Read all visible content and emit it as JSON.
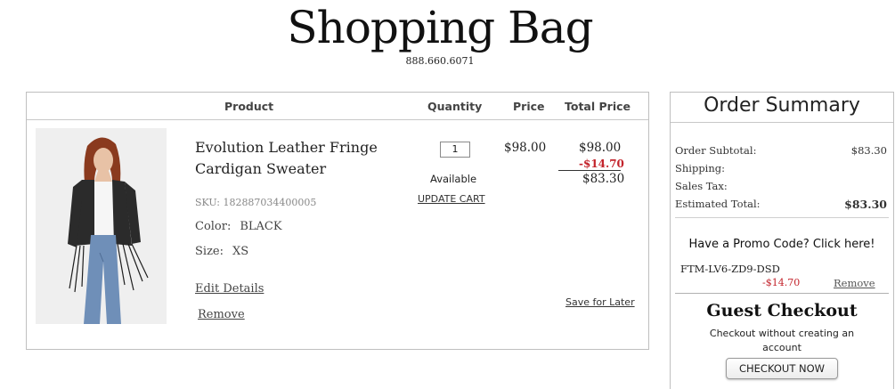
{
  "header": {
    "title": "Shopping Bag",
    "phone": "888.660.6071"
  },
  "cart": {
    "columns": {
      "product": "Product",
      "quantity": "Quantity",
      "price": "Price",
      "total": "Total Price"
    },
    "item": {
      "name": "Evolution Leather Fringe Cardigan Sweater",
      "sku": "SKU: 182887034400005",
      "color_label": "Color:",
      "color_value": "BLACK",
      "size_label": "Size:",
      "size_value": "XS",
      "edit_label": "Edit Details",
      "remove_label": "Remove",
      "quantity": "1",
      "availability": "Available",
      "update_label": "UPDATE CART",
      "unit_price": "$98.00",
      "total_original": "$98.00",
      "total_discount": "-$14.70",
      "total_final": "$83.30",
      "save_label": "Save for Later"
    }
  },
  "summary": {
    "title": "Order Summary",
    "rows": [
      {
        "label": "Order Subtotal:",
        "value": "$83.30"
      },
      {
        "label": "Shipping:",
        "value": ""
      },
      {
        "label": "Sales Tax:",
        "value": ""
      },
      {
        "label": "Estimated Total:",
        "value": "$83.30"
      }
    ],
    "promo_prompt": "Have a Promo Code? Click here!",
    "promo_code": "FTM-LV6-ZD9-DSD",
    "promo_amount": "-$14.70",
    "promo_remove": "Remove",
    "guest_title": "Guest Checkout",
    "guest_desc": "Checkout without creating an account",
    "checkout_label": "CHECKOUT NOW"
  },
  "colors": {
    "discount": "#c3232b",
    "border": "#bfbfbf"
  }
}
